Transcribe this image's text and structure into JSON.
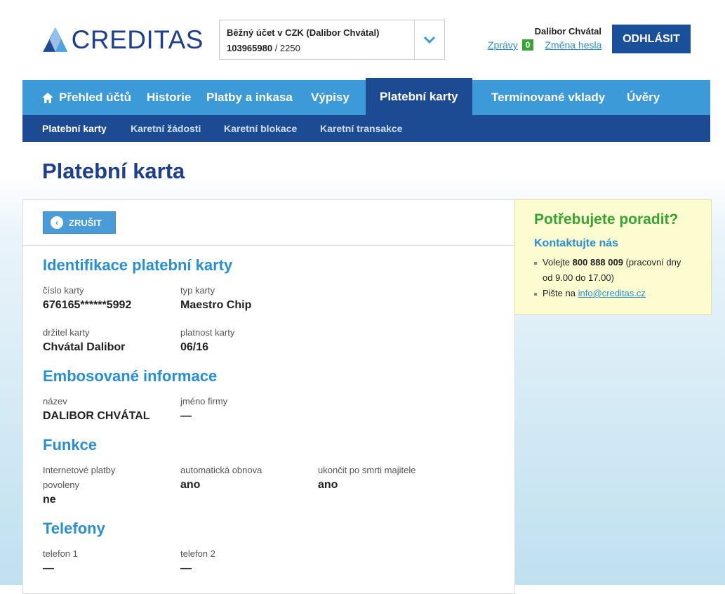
{
  "brand": {
    "logo_text": "CREDITAS",
    "color": "#1d3f8e"
  },
  "account": {
    "name": "Běžný účet v CZK (Dalibor Chvátal)",
    "number": "103965980",
    "bank_code": "/ 2250"
  },
  "user": {
    "name": "Dalibor Chvátal",
    "messages_label": "Zprávy",
    "messages_count": "0",
    "change_password_label": "Změna hesla",
    "logout_label": "ODHLÁSIT"
  },
  "main_nav": [
    {
      "label": "Přehled účtů",
      "icon": "home-icon"
    },
    {
      "label": "Historie"
    },
    {
      "label": "Platby a inkasa"
    },
    {
      "label": "Výpisy"
    },
    {
      "label": "Platební karty",
      "active": true
    },
    {
      "label": "Termínované vklady"
    },
    {
      "label": "Úvěry"
    }
  ],
  "sub_nav": [
    {
      "label": "Platební karty",
      "active": true
    },
    {
      "label": "Karetní žádosti"
    },
    {
      "label": "Karetní blokace"
    },
    {
      "label": "Karetní transakce"
    }
  ],
  "page": {
    "title": "Platební karta",
    "cancel_label": "ZRUŠIT",
    "sections": {
      "identification": {
        "title": "Identifikace platební karty",
        "card_number_label": "číslo karty",
        "card_number": "676165******5992",
        "card_type_label": "typ karty",
        "card_type": "Maestro Chip",
        "holder_label": "držitel karty",
        "holder": "Chvátal Dalibor",
        "validity_label": "platnost karty",
        "validity": "06/16"
      },
      "embossed": {
        "title": "Embosované informace",
        "name_label": "název",
        "name": "DALIBOR CHVÁTAL",
        "company_label": "jméno firmy",
        "company": "—"
      },
      "functions": {
        "title": "Funkce",
        "internet_label": "Internetové platby povoleny",
        "internet": "ne",
        "renewal_label": "automatická obnova",
        "renewal": "ano",
        "terminate_label": "ukončit po smrti majitele",
        "terminate": "ano"
      },
      "phones": {
        "title": "Telefony",
        "phone1_label": "telefon 1",
        "phone1": "—",
        "phone2_label": "telefon 2",
        "phone2": "—"
      }
    }
  },
  "help": {
    "title": "Potřebujete poradit?",
    "contact_title": "Kontaktujte nás",
    "call_prefix": "Volejte",
    "phone": "800 888 009",
    "call_suffix": "(pracovní dny od 9.00 do 17.00)",
    "write_prefix": "Pište na",
    "email": "info@creditas.cz"
  }
}
